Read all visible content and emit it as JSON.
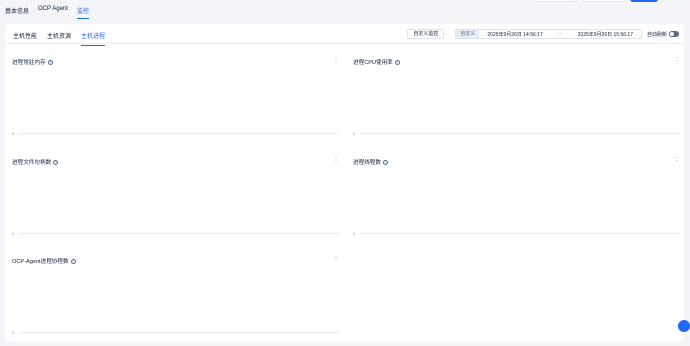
{
  "top_tabs": [
    "基本信息",
    "OCP Agent",
    "监控"
  ],
  "sub_tabs": [
    "主机性能",
    "主机资源",
    "主机进程"
  ],
  "toolbar": {
    "custom_monitor_label": "自定义监控",
    "range_tag": "自定义",
    "start_time": "2025年9月26日 14:56:17",
    "range_separator": "~",
    "end_time": "2025年9月26日 15:56:17",
    "auto_refresh_label": "自动刷新"
  },
  "panels": [
    {
      "title": "进程常驻内存",
      "axis_zero": "0"
    },
    {
      "title": "进程CPU使用率",
      "axis_zero": "0"
    },
    {
      "title": "进程文件句柄数",
      "axis_zero": "0"
    },
    {
      "title": "进程线程数",
      "axis_zero": "0"
    },
    {
      "title": "OCP-Agent进程协程数",
      "axis_zero": "0"
    }
  ],
  "colors": {
    "accent": "#1e69f5",
    "text": "#132039",
    "muted": "#8592a6"
  },
  "icons": {
    "help": "question-circle-icon",
    "drag": "drag-handle-icon",
    "fab": "floating-action-icon"
  }
}
